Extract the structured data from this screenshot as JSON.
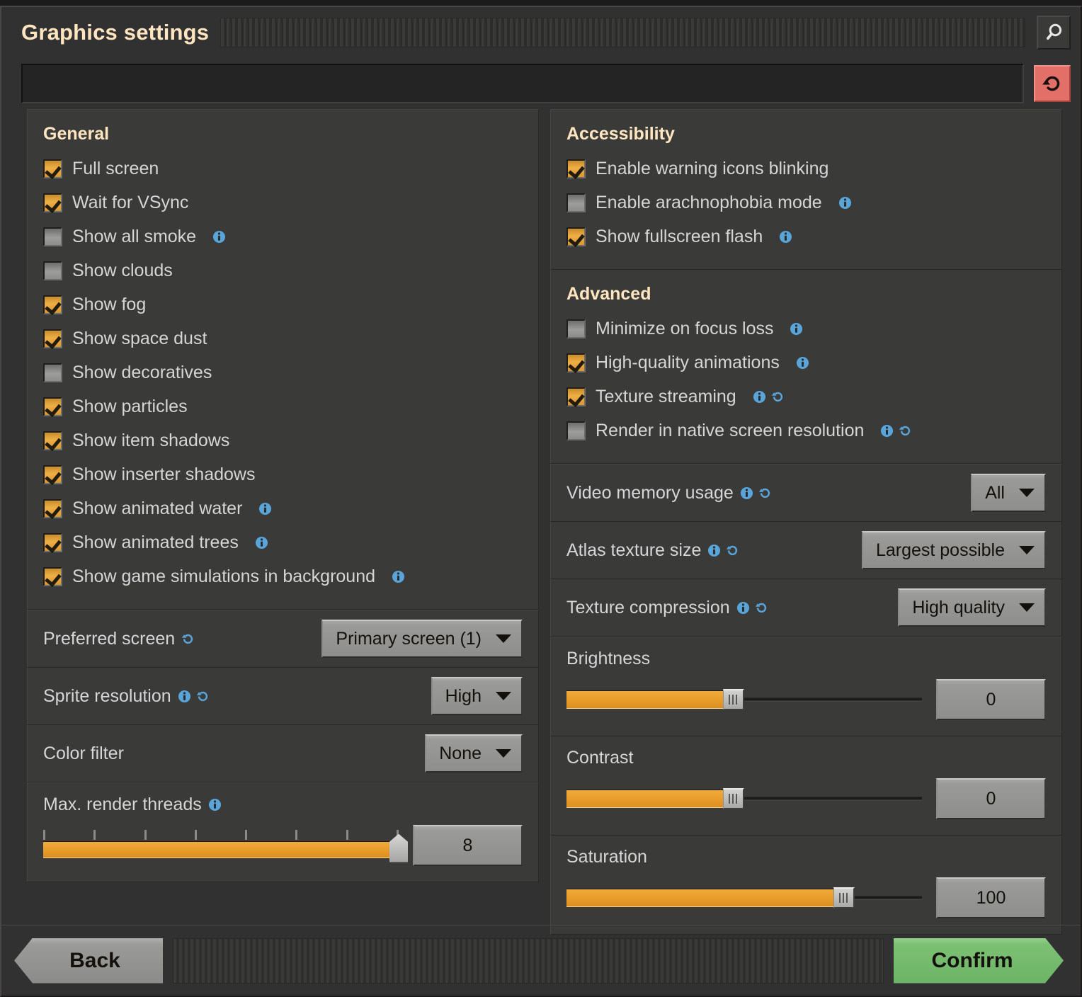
{
  "window": {
    "title": "Graphics settings",
    "search_icon": "search-icon",
    "reset_icon": "reset-icon",
    "search_value": "",
    "search_placeholder": ""
  },
  "colors": {
    "accent_orange": "#e79a28",
    "title_text": "#ffe6c0",
    "info_icon_blue": "#59a4d8",
    "reset_button_red": "#e26f68",
    "confirm_green": "#7cc074"
  },
  "left_column": {
    "general": {
      "title": "General",
      "checkboxes": [
        {
          "label": "Full screen",
          "checked": true,
          "info": false,
          "restart": false
        },
        {
          "label": "Wait for VSync",
          "checked": true,
          "info": false,
          "restart": false
        },
        {
          "label": "Show all smoke",
          "checked": false,
          "info": true,
          "restart": false
        },
        {
          "label": "Show clouds",
          "checked": false,
          "info": false,
          "restart": false
        },
        {
          "label": "Show fog",
          "checked": true,
          "info": false,
          "restart": false
        },
        {
          "label": "Show space dust",
          "checked": true,
          "info": false,
          "restart": false
        },
        {
          "label": "Show decoratives",
          "checked": false,
          "info": false,
          "restart": false
        },
        {
          "label": "Show particles",
          "checked": true,
          "info": false,
          "restart": false
        },
        {
          "label": "Show item shadows",
          "checked": true,
          "info": false,
          "restart": false
        },
        {
          "label": "Show inserter shadows",
          "checked": true,
          "info": false,
          "restart": false
        },
        {
          "label": "Show animated water",
          "checked": true,
          "info": true,
          "restart": false
        },
        {
          "label": "Show animated trees",
          "checked": true,
          "info": true,
          "restart": false
        },
        {
          "label": "Show game simulations in background",
          "checked": true,
          "info": true,
          "restart": false
        }
      ]
    },
    "dropdowns": [
      {
        "label": "Preferred screen",
        "value": "Primary screen (1)",
        "info": false,
        "restart": true
      },
      {
        "label": "Sprite resolution",
        "value": "High",
        "info": true,
        "restart": true
      },
      {
        "label": "Color filter",
        "value": "None",
        "info": false,
        "restart": false
      }
    ],
    "slider": {
      "label": "Max. render threads",
      "info": true,
      "value": "8",
      "percent": 100,
      "tick_count": 8
    }
  },
  "right_column": {
    "accessibility": {
      "title": "Accessibility",
      "checkboxes": [
        {
          "label": "Enable warning icons blinking",
          "checked": true,
          "info": false,
          "restart": false
        },
        {
          "label": "Enable arachnophobia mode",
          "checked": false,
          "info": true,
          "restart": false
        },
        {
          "label": "Show fullscreen flash",
          "checked": true,
          "info": true,
          "restart": false
        }
      ]
    },
    "advanced": {
      "title": "Advanced",
      "checkboxes": [
        {
          "label": "Minimize on focus loss",
          "checked": false,
          "info": true,
          "restart": false
        },
        {
          "label": "High-quality animations",
          "checked": true,
          "info": true,
          "restart": false
        },
        {
          "label": "Texture streaming",
          "checked": true,
          "info": true,
          "restart": true
        },
        {
          "label": "Render in native screen resolution",
          "checked": false,
          "info": true,
          "restart": true
        }
      ]
    },
    "dropdowns": [
      {
        "label": "Video memory usage",
        "value": "All",
        "info": true,
        "restart": true
      },
      {
        "label": "Atlas texture size",
        "value": "Largest possible",
        "info": true,
        "restart": true
      },
      {
        "label": "Texture compression",
        "value": "High quality",
        "info": true,
        "restart": true
      }
    ],
    "sliders": [
      {
        "label": "Brightness",
        "value": "0",
        "percent": 47,
        "info": false
      },
      {
        "label": "Contrast",
        "value": "0",
        "percent": 47,
        "info": false
      },
      {
        "label": "Saturation",
        "value": "100",
        "percent": 78,
        "info": false
      }
    ]
  },
  "footer": {
    "back_label": "Back",
    "confirm_label": "Confirm"
  }
}
